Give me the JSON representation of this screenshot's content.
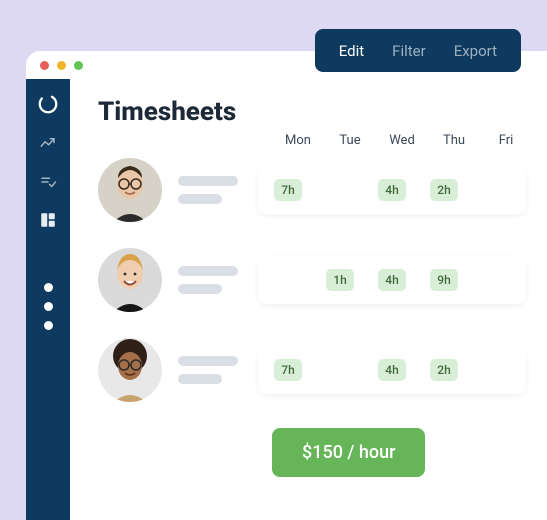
{
  "toolbar": {
    "items": [
      {
        "label": "Edit",
        "active": true
      },
      {
        "label": "Filter",
        "active": false
      },
      {
        "label": "Export",
        "active": false
      }
    ]
  },
  "page": {
    "title": "Timesheets"
  },
  "days": [
    "Mon",
    "Tue",
    "Wed",
    "Thu",
    "Fri"
  ],
  "rows": [
    {
      "hours": [
        "7h",
        "",
        "4h",
        "2h",
        ""
      ]
    },
    {
      "hours": [
        "",
        "1h",
        "4h",
        "9h",
        ""
      ]
    },
    {
      "hours": [
        "7h",
        "",
        "4h",
        "2h",
        ""
      ]
    }
  ],
  "rate": {
    "label": "$150 / hour"
  },
  "colors": {
    "navy": "#0D3A5E",
    "lavender": "#DDD9F3",
    "pillBg": "#D9EED6",
    "green": "#67B559"
  }
}
